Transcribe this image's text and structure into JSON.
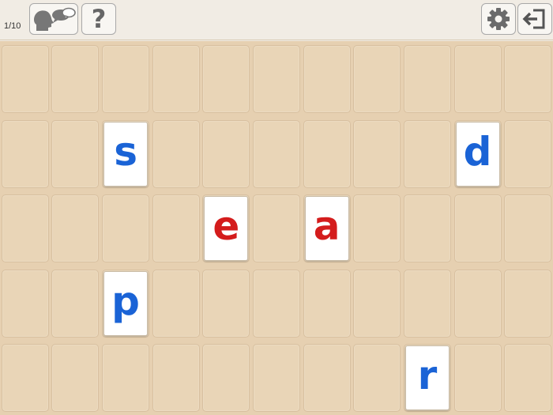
{
  "topbar": {
    "progress_label": "1/10",
    "buttons": [
      {
        "name": "speak-button",
        "icon": "speaking-heads-icon"
      },
      {
        "name": "help-button",
        "icon": "question-mark-icon",
        "glyph": "?"
      },
      {
        "name": "settings-button",
        "icon": "gear-icon"
      },
      {
        "name": "exit-button",
        "icon": "exit-arrow-icon"
      }
    ]
  },
  "board": {
    "rows": 5,
    "columns": 11,
    "tiles": [
      {
        "letter": "s",
        "color": "#1a63d6",
        "row": 2,
        "col": 3
      },
      {
        "letter": "d",
        "color": "#1a63d6",
        "row": 2,
        "col": 10
      },
      {
        "letter": "e",
        "color": "#d41c1c",
        "row": 3,
        "col": 5
      },
      {
        "letter": "a",
        "color": "#d41c1c",
        "row": 3,
        "col": 7
      },
      {
        "letter": "p",
        "color": "#1a63d6",
        "row": 4,
        "col": 3
      },
      {
        "letter": "r",
        "color": "#1a63d6",
        "row": 5,
        "col": 9
      }
    ]
  },
  "colors": {
    "vowel": "#d41c1c",
    "consonant": "#1a63d6",
    "board": "#e6d0b1",
    "topbar": "#f1ece4"
  }
}
